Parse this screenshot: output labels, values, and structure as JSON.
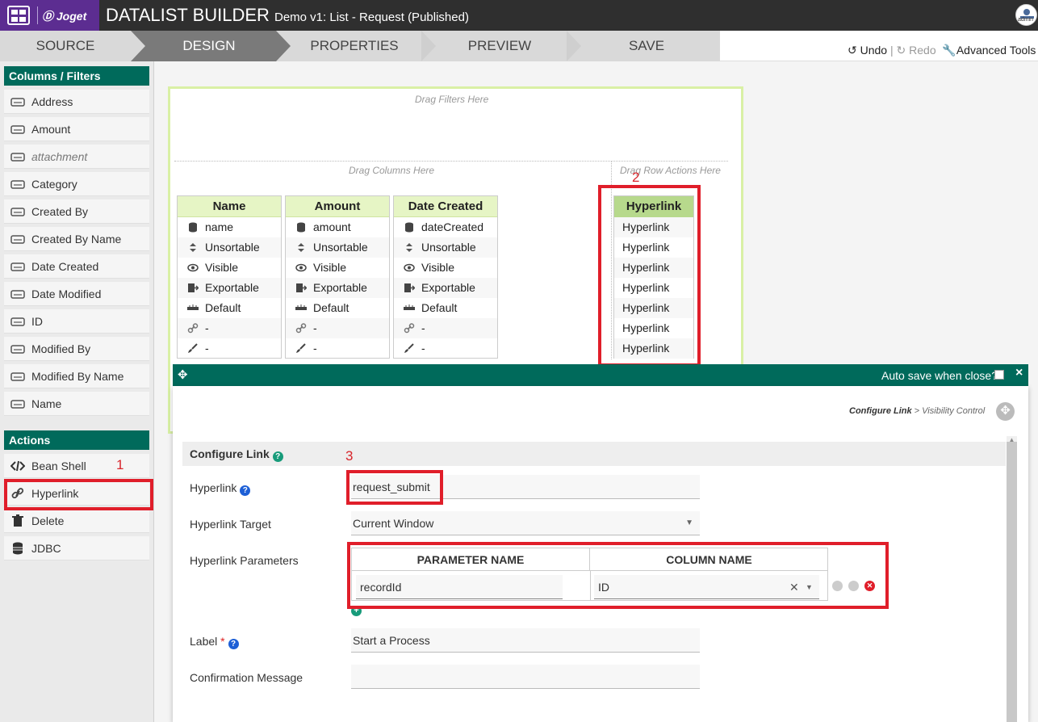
{
  "header": {
    "brand": "Joget",
    "title": "DATALIST BUILDER",
    "subtitle": "Demo v1: List - Request (Published)",
    "avatar_label": "admin"
  },
  "tabs": [
    {
      "label": "SOURCE",
      "active": false
    },
    {
      "label": "DESIGN",
      "active": true
    },
    {
      "label": "PROPERTIES",
      "active": false
    },
    {
      "label": "PREVIEW",
      "active": false
    },
    {
      "label": "SAVE",
      "active": false
    }
  ],
  "toolbar": {
    "undo": "Undo",
    "separator": "|",
    "redo": "Redo",
    "advanced": "Advanced Tools"
  },
  "palette": {
    "columns_title": "Columns / Filters",
    "columns": [
      {
        "label": "Address",
        "italic": false
      },
      {
        "label": "Amount",
        "italic": false
      },
      {
        "label": "attachment",
        "italic": true
      },
      {
        "label": "Category",
        "italic": false
      },
      {
        "label": "Created By",
        "italic": false
      },
      {
        "label": "Created By Name",
        "italic": false
      },
      {
        "label": "Date Created",
        "italic": false
      },
      {
        "label": "Date Modified",
        "italic": false
      },
      {
        "label": "ID",
        "italic": false
      },
      {
        "label": "Modified By",
        "italic": false
      },
      {
        "label": "Modified By Name",
        "italic": false
      },
      {
        "label": "Name",
        "italic": false
      }
    ],
    "actions_title": "Actions",
    "actions": [
      {
        "label": "Bean Shell",
        "icon": "code-icon"
      },
      {
        "label": "Hyperlink",
        "icon": "link-icon"
      },
      {
        "label": "Delete",
        "icon": "trash-icon"
      },
      {
        "label": "JDBC",
        "icon": "database-icon"
      }
    ]
  },
  "canvas": {
    "drag_filters": "Drag Filters Here",
    "drag_columns": "Drag Columns Here",
    "drag_row_actions": "Drag Row Actions Here",
    "columns": [
      {
        "header": "Name",
        "rows": [
          "name",
          "Unsortable",
          "Visible",
          "Exportable",
          "Default",
          "-",
          "-"
        ]
      },
      {
        "header": "Amount",
        "rows": [
          "amount",
          "Unsortable",
          "Visible",
          "Exportable",
          "Default",
          "-",
          "-"
        ]
      },
      {
        "header": "Date Created",
        "rows": [
          "dateCreated",
          "Unsortable",
          "Visible",
          "Exportable",
          "Default",
          "-",
          "-"
        ]
      }
    ],
    "row_action": {
      "header": "Hyperlink",
      "rows": [
        "Hyperlink",
        "Hyperlink",
        "Hyperlink",
        "Hyperlink",
        "Hyperlink",
        "Hyperlink",
        "Hyperlink"
      ]
    }
  },
  "annotations": {
    "a1": "1",
    "a2": "2",
    "a3": "3"
  },
  "dialog": {
    "auto_save": "Auto save when close?",
    "close": "×",
    "crumb_current": "Configure Link",
    "crumb_sep": ">",
    "crumb_next": "Visibility Control",
    "section_title": "Configure Link",
    "fields": {
      "hyperlink_label": "Hyperlink",
      "hyperlink_value": "request_submit",
      "target_label": "Hyperlink Target",
      "target_value": "Current Window",
      "params_label": "Hyperlink Parameters",
      "param_col_header": "PARAMETER NAME",
      "column_col_header": "COLUMN NAME",
      "param_value": "recordId",
      "column_value": "ID",
      "label_label": "Label",
      "label_required": "*",
      "label_value": "Start a Process",
      "confirm_label": "Confirmation Message",
      "confirm_value": ""
    }
  },
  "colors": {
    "accent": "#006a5b",
    "brand": "#5c2d91",
    "highlight": "#e01e2a"
  }
}
